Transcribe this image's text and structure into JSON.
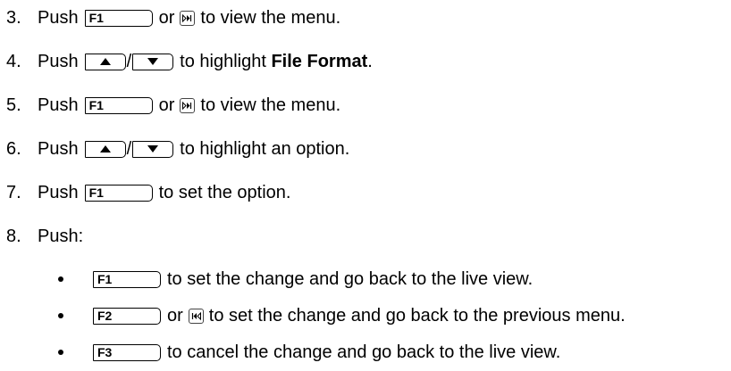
{
  "steps": [
    {
      "num": "3.",
      "pre": "Push",
      "key": "F1",
      "mid": "or",
      "post": "to view the menu."
    },
    {
      "num": "4.",
      "pre": "Push",
      "sep": "/",
      "post_prefix": "to highlight",
      "post_bold": "File Format",
      "post_end": "."
    },
    {
      "num": "5.",
      "pre": "Push",
      "key": "F1",
      "mid": "or",
      "post": "to view the menu."
    },
    {
      "num": "6.",
      "pre": "Push",
      "sep": "/",
      "post": "to highlight an option."
    },
    {
      "num": "7.",
      "pre": "Push",
      "key": "F1",
      "post": "to set the option."
    },
    {
      "num": "8.",
      "pre": "Push:"
    }
  ],
  "substeps": [
    {
      "key": "F1",
      "post": "to set the change and go back to the live view."
    },
    {
      "key": "F2",
      "mid": "or",
      "post": "to set the change and go back to the previous menu."
    },
    {
      "key": "F3",
      "post": "to cancel the change and go back to the live view."
    }
  ],
  "icons": {
    "next": "play-next-icon",
    "back": "play-back-icon",
    "up": "arrow-up-icon",
    "down": "arrow-down-icon"
  }
}
